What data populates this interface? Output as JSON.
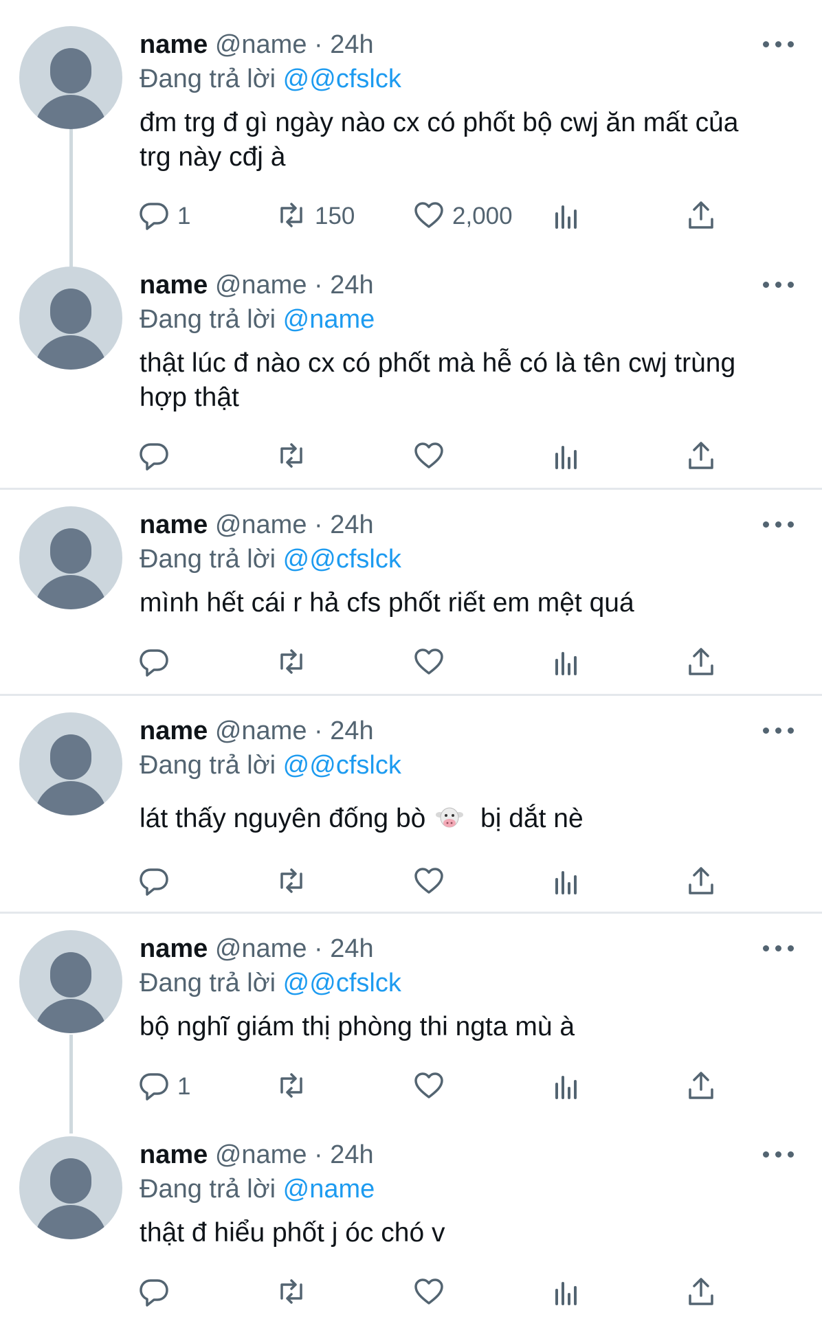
{
  "tweets": [
    {
      "display_name": "name",
      "handle": "@name",
      "dot": "·",
      "time": "24h",
      "reply_prefix": "Đang trả lời",
      "reply_to": "@@cfslck",
      "text": "đm trg đ gì ngày nào cx có phốt bộ cwj ăn mất của trg này cđj à",
      "replies": "1",
      "retweets": "150",
      "likes": "2,000"
    },
    {
      "display_name": "name",
      "handle": "@name",
      "dot": "·",
      "time": "24h",
      "reply_prefix": "Đang trả lời",
      "reply_to": "@name",
      "text": "thật lúc đ nào cx có phốt mà hễ có là tên cwj trùng hợp thật",
      "replies": "",
      "retweets": "",
      "likes": ""
    },
    {
      "display_name": "name",
      "handle": "@name",
      "dot": "·",
      "time": "24h",
      "reply_prefix": "Đang trả lời",
      "reply_to": "@@cfslck",
      "text": "mình hết cái r hả cfs phốt riết em mệt quá",
      "replies": "",
      "retweets": "",
      "likes": ""
    },
    {
      "display_name": "name",
      "handle": "@name",
      "dot": "·",
      "time": "24h",
      "reply_prefix": "Đang trả lời",
      "reply_to": "@@cfslck",
      "text_before_emoji": "lát thấy nguyên đống bò",
      "emoji": "cow-face-emoji",
      "text_after_emoji": "bị dắt nè",
      "replies": "",
      "retweets": "",
      "likes": ""
    },
    {
      "display_name": "name",
      "handle": "@name",
      "dot": "·",
      "time": "24h",
      "reply_prefix": "Đang trả lời",
      "reply_to": "@@cfslck",
      "text": "bộ nghĩ giám thị phòng thi ngta mù à",
      "replies": "1",
      "retweets": "",
      "likes": ""
    },
    {
      "display_name": "name",
      "handle": "@name",
      "dot": "·",
      "time": "24h",
      "reply_prefix": "Đang trả lời",
      "reply_to": "@name",
      "text": "thật đ hiểu phốt j óc chó v",
      "replies": "",
      "retweets": "",
      "likes": ""
    }
  ],
  "icons": {
    "reply": "reply-icon",
    "retweet": "retweet-icon",
    "like": "heart-icon",
    "views": "analytics-icon",
    "share": "share-icon",
    "more": "more-icon"
  },
  "colors": {
    "text": "#0f1419",
    "secondary": "#536471",
    "accent": "#1d9bf0",
    "avatar_bg": "#ccd6dd",
    "avatar_fg": "#68788a",
    "thread_line": "#cfd9de",
    "divider": "#e4e8ec"
  }
}
